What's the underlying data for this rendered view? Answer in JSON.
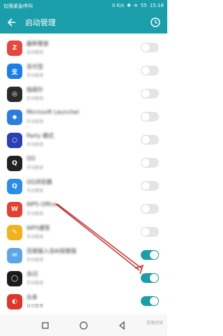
{
  "status_bar": {
    "left_text": "仅限紧急呼叫",
    "speed": "0 K/s",
    "battery": "55",
    "time": "15:18"
  },
  "app_bar": {
    "title": "启动管理"
  },
  "apps": [
    {
      "name": "最新管家",
      "subtitle": "自动管理",
      "icon_text": "Z",
      "icon_color": "#e8473d",
      "enabled": false,
      "blurred": true
    },
    {
      "name": "支付宝",
      "subtitle": "手动管理",
      "icon_text": "支",
      "icon_color": "#1a7fe8",
      "enabled": false,
      "blurred": true
    },
    {
      "name": "指南针",
      "subtitle": "手动管理",
      "icon_text": "◎",
      "icon_color": "#2b2b2b",
      "enabled": false,
      "blurred": true
    },
    {
      "name": "Microsoft Launcher",
      "subtitle": "手动管理",
      "icon_text": "◆",
      "icon_color": "#2b7de0",
      "enabled": false,
      "blurred": true
    },
    {
      "name": "Party 模式",
      "subtitle": "手动管理",
      "icon_text": "○",
      "icon_color": "#2a3eb8",
      "enabled": false,
      "blurred": true
    },
    {
      "name": "QQ",
      "subtitle": "手动管理",
      "icon_text": "Q",
      "icon_color": "#222222",
      "enabled": false,
      "blurred": true
    },
    {
      "name": "QQ浏览器",
      "subtitle": "手动管理",
      "icon_text": "Q",
      "icon_color": "#2a8de8",
      "enabled": false,
      "blurred": true
    },
    {
      "name": "WPS Office",
      "subtitle": "手动管理",
      "icon_text": "W",
      "icon_color": "#e3402f",
      "enabled": false,
      "blurred": true
    },
    {
      "name": "WPS便签",
      "subtitle": "手动管理",
      "icon_text": "✎",
      "icon_color": "#f2b21c",
      "enabled": false,
      "blurred": true
    },
    {
      "name": "百度输入法AI探索版",
      "subtitle": "手动管理",
      "icon_text": "✉",
      "icon_color": "#5aa6e8",
      "enabled": true,
      "blurred": true
    },
    {
      "name": "多闪",
      "subtitle": "手动管理",
      "icon_text": "◯",
      "icon_color": "#1b1b1b",
      "enabled": true,
      "blurred": true
    },
    {
      "name": "头条",
      "subtitle": "自动管理",
      "icon_text": "◐",
      "icon_color": "#e0352b",
      "enabled": true,
      "blurred": true,
      "subtitle_clear": true
    }
  ],
  "nav": {
    "back": "back",
    "home": "home",
    "recent": "recent",
    "watermark": "百度经验"
  },
  "colors": {
    "accent": "#1a9faa",
    "arrow": "#c9302c"
  }
}
